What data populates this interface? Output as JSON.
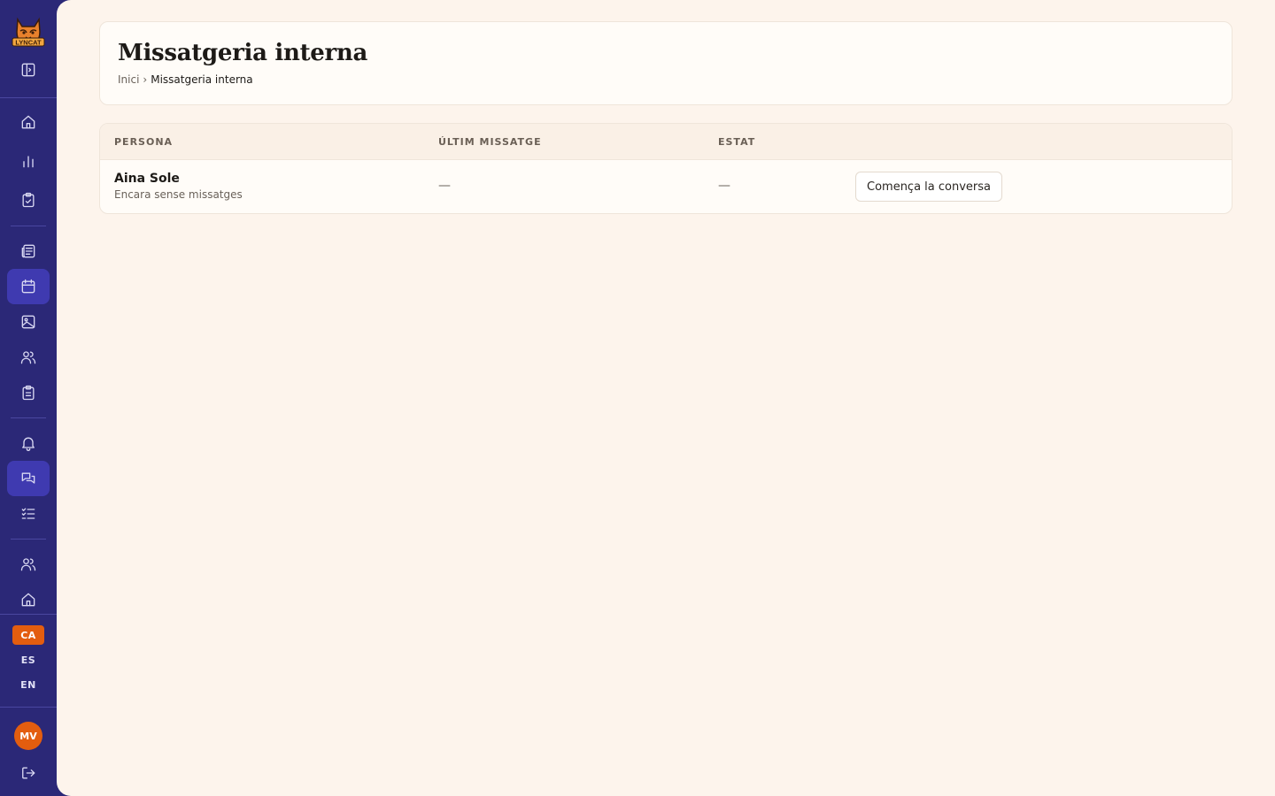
{
  "app": {
    "logo_text": "LYNCAT",
    "brand_color": "#2b2877",
    "accent_color": "#e35d0f"
  },
  "sidebar": {
    "items": [
      {
        "icon": "sidebar-toggle-icon",
        "label": "Toggle sidebar"
      },
      {
        "icon": "home-icon",
        "label": "Home"
      },
      {
        "icon": "bar-chart-icon",
        "label": "Stats"
      },
      {
        "icon": "clipboard-check-icon",
        "label": "Tasks"
      },
      {
        "icon": "newspaper-icon",
        "label": "News"
      },
      {
        "icon": "calendar-icon",
        "label": "Calendar"
      },
      {
        "icon": "image-icon",
        "label": "Gallery"
      },
      {
        "icon": "users-icon",
        "label": "People"
      },
      {
        "icon": "clipboard-list-icon",
        "label": "Lists"
      },
      {
        "icon": "bell-icon",
        "label": "Notifications"
      },
      {
        "icon": "messages-icon",
        "label": "Messages",
        "active": true
      },
      {
        "icon": "checklist-icon",
        "label": "Checklist"
      },
      {
        "icon": "users-icon",
        "label": "Team"
      },
      {
        "icon": "home-icon",
        "label": "House"
      }
    ],
    "languages": [
      "CA",
      "ES",
      "EN"
    ],
    "active_language": "CA",
    "avatar_initials": "MV",
    "logout_icon": "logout-icon"
  },
  "header": {
    "title": "Missatgeria interna",
    "breadcrumb": {
      "home": "Inici",
      "separator": "›",
      "current": "Missatgeria interna"
    }
  },
  "table": {
    "columns": [
      "PERSONA",
      "ÚLTIM MISSATGE",
      "ESTAT"
    ],
    "rows": [
      {
        "name": "Aina Sole",
        "subtitle": "Encara sense missatges",
        "last_message": "—",
        "status": "—",
        "action_label": "Comença la conversa"
      }
    ]
  }
}
